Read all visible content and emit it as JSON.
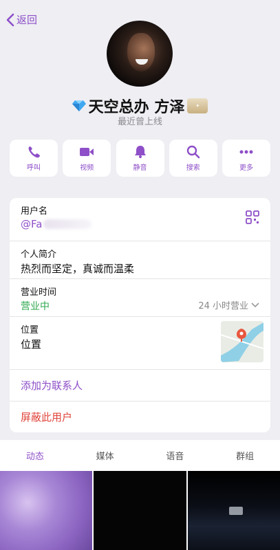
{
  "nav": {
    "back_label": "返回"
  },
  "profile": {
    "name": "天空总办 方泽",
    "status": "最近曾上线",
    "badge_icon": "diamond-icon",
    "accent": "#8e4fc8"
  },
  "actions": [
    {
      "label": "呼叫",
      "icon": "phone-icon"
    },
    {
      "label": "视频",
      "icon": "video-icon"
    },
    {
      "label": "静音",
      "icon": "bell-icon"
    },
    {
      "label": "搜索",
      "icon": "search-icon"
    },
    {
      "label": "更多",
      "icon": "more-icon"
    }
  ],
  "info": {
    "username_label": "用户名",
    "username_value": "@Fa",
    "bio_label": "个人简介",
    "bio_value": "热烈而坚定，真诚而温柔",
    "hours_label": "营业时间",
    "hours_status": "营业中",
    "hours_value": "24 小时营业",
    "location_label": "位置",
    "location_value": "位置",
    "add_contact": "添加为联系人",
    "block_user": "屏蔽此用户"
  },
  "tabs": [
    {
      "label": "动态",
      "active": true
    },
    {
      "label": "媒体",
      "active": false
    },
    {
      "label": "语音",
      "active": false
    },
    {
      "label": "群组",
      "active": false
    }
  ]
}
